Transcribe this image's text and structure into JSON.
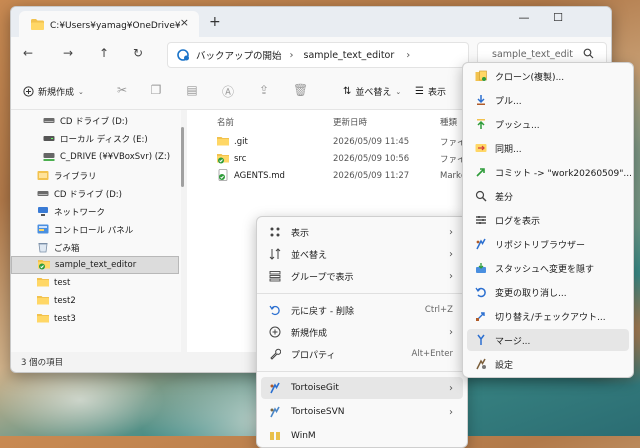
{
  "window": {
    "tab_title": "C:¥Users¥yamag¥OneDrive¥デ",
    "close_glyph": "×",
    "new_tab_glyph": "+",
    "minimize_glyph": "—",
    "maximize_glyph": "☐",
    "close_window_glyph": "✕"
  },
  "nav": {
    "back_glyph": "←",
    "forward_glyph": "→",
    "up_glyph": "↑",
    "refresh_glyph": "↻",
    "breadcrumb": [
      "バックアップの開始",
      "sample_text_editor"
    ],
    "sep_glyph": "›",
    "search_placeholder": "sample_text_edit"
  },
  "toolbar": {
    "new_label": "新規作成",
    "sort_label": "並べ替え",
    "view_label": "表示"
  },
  "sidebar": {
    "items": [
      {
        "label": "CD ドライブ (D:)",
        "icon": "cd-drive-icon",
        "indent": 1
      },
      {
        "label": "ローカル ディスク (E:)",
        "icon": "disk-icon",
        "indent": 1
      },
      {
        "label": "C_DRIVE (¥¥VBoxSvr) (Z:)",
        "icon": "network-drive-icon",
        "indent": 1
      },
      {
        "label": "ライブラリ",
        "icon": "library-icon",
        "indent": 0
      },
      {
        "label": "CD ドライブ (D:)",
        "icon": "cd-drive-icon",
        "indent": 0
      },
      {
        "label": "ネットワーク",
        "icon": "network-icon",
        "indent": 0
      },
      {
        "label": "コントロール パネル",
        "icon": "control-panel-icon",
        "indent": 0
      },
      {
        "label": "ごみ箱",
        "icon": "recycle-bin-icon",
        "indent": 0
      },
      {
        "label": "sample_text_editor",
        "icon": "git-folder-icon",
        "indent": 0,
        "selected": true
      },
      {
        "label": "test",
        "icon": "folder-icon",
        "indent": 0
      },
      {
        "label": "test2",
        "icon": "folder-icon",
        "indent": 0
      },
      {
        "label": "test3",
        "icon": "folder-icon",
        "indent": 0
      }
    ]
  },
  "content": {
    "columns": [
      "名前",
      "更新日時",
      "種類"
    ],
    "rows": [
      {
        "name": ".git",
        "date": "2026/05/09 11:45",
        "type": "ファイル",
        "icon": "folder-icon"
      },
      {
        "name": "src",
        "date": "2026/05/09 10:56",
        "type": "ファイル",
        "icon": "git-folder-icon"
      },
      {
        "name": "AGENTS.md",
        "date": "2026/05/09 11:27",
        "type": "Markd",
        "icon": "git-file-icon"
      }
    ]
  },
  "status": {
    "item_count": "3 個の項目"
  },
  "context_menu": {
    "items": [
      {
        "label": "表示",
        "icon": "grid-icon",
        "arrow": true
      },
      {
        "label": "並べ替え",
        "icon": "sort-icon",
        "arrow": true
      },
      {
        "label": "グループで表示",
        "icon": "group-icon",
        "arrow": true
      },
      {
        "label": "元に戻す - 削除",
        "icon": "undo-icon",
        "shortcut": "Ctrl+Z"
      },
      {
        "label": "新規作成",
        "icon": "plus-icon",
        "arrow": true
      },
      {
        "label": "プロパティ",
        "icon": "wrench-icon",
        "shortcut": "Alt+Enter"
      },
      {
        "label": "TortoiseGit",
        "icon": "tortoisegit-icon",
        "arrow": true,
        "highlighted": true
      },
      {
        "label": "TortoiseSVN",
        "icon": "tortoisesvn-icon",
        "arrow": true
      },
      {
        "label": "WinM",
        "icon": "winmerge-icon"
      }
    ],
    "arrow_glyph": "›"
  },
  "tortoisegit_menu": {
    "items": [
      {
        "label": "クローン(複製)...",
        "icon": "clone-icon"
      },
      {
        "label": "プル...",
        "icon": "pull-icon"
      },
      {
        "label": "プッシュ...",
        "icon": "push-icon"
      },
      {
        "label": "同期...",
        "icon": "sync-icon"
      },
      {
        "label": "コミット -> \"work20260509\"...",
        "icon": "commit-icon"
      },
      {
        "label": "差分",
        "icon": "diff-icon"
      },
      {
        "label": "ログを表示",
        "icon": "log-icon"
      },
      {
        "label": "リポジトリブラウザー",
        "icon": "repo-browser-icon"
      },
      {
        "label": "スタッシュへ変更を隠す",
        "icon": "stash-icon"
      },
      {
        "label": "変更の取り消し...",
        "icon": "revert-icon"
      },
      {
        "label": "切り替え/チェックアウト...",
        "icon": "switch-icon"
      },
      {
        "label": "マージ...",
        "icon": "merge-icon",
        "highlighted": true
      },
      {
        "label": "設定",
        "icon": "settings-icon"
      }
    ]
  }
}
